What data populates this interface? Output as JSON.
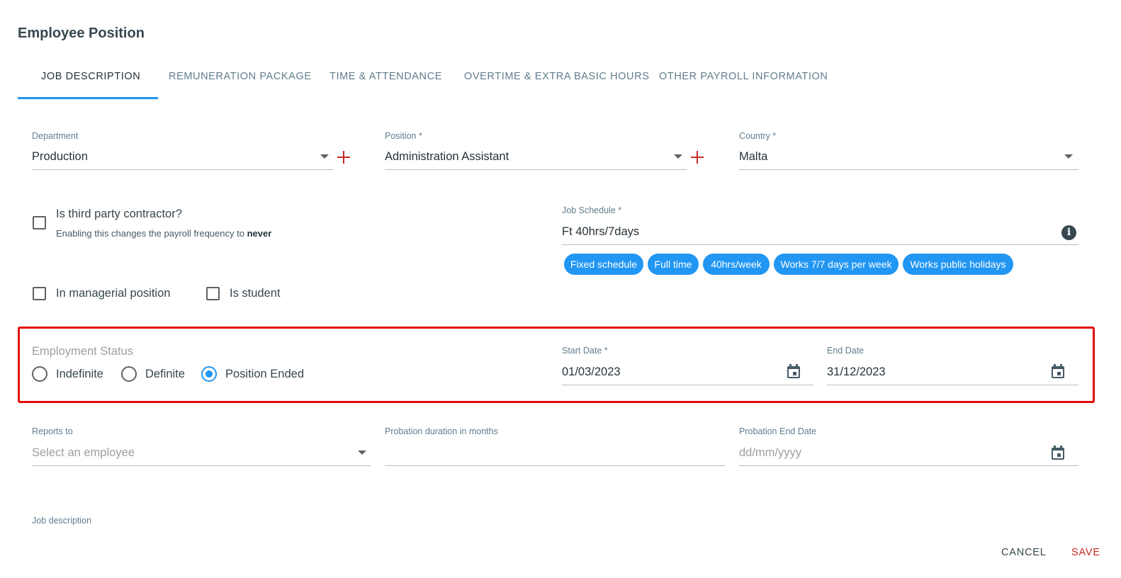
{
  "dialog": {
    "title": "Employee Position"
  },
  "tabs": [
    {
      "label": "JOB DESCRIPTION",
      "active": true
    },
    {
      "label": "REMUNERATION PACKAGE",
      "active": false
    },
    {
      "label": "TIME & ATTENDANCE",
      "active": false
    },
    {
      "label": "OVERTIME & EXTRA BASIC HOURS",
      "active": false
    },
    {
      "label": "OTHER PAYROLL INFORMATION",
      "active": false
    }
  ],
  "department": {
    "label": "Department",
    "value": "Production"
  },
  "position": {
    "label": "Position *",
    "value": "Administration Assistant"
  },
  "country": {
    "label": "Country *",
    "value": "Malta"
  },
  "third_party": {
    "label": "Is third party contractor?",
    "hint": "Enabling this changes the payroll frequency to ",
    "hint_bold": "never",
    "checked": false
  },
  "job_schedule": {
    "label": "Job Schedule *",
    "value": "Ft 40hrs/7days",
    "chips": [
      "Fixed schedule",
      "Full time",
      "40hrs/week",
      "Works 7/7 days per week",
      "Works public holidays"
    ]
  },
  "managerial": {
    "label": "In managerial position",
    "checked": false
  },
  "student": {
    "label": "Is student",
    "checked": false
  },
  "employment_status": {
    "label": "Employment Status",
    "options": [
      "Indefinite",
      "Definite",
      "Position Ended"
    ],
    "selected": "Position Ended"
  },
  "start_date": {
    "label": "Start Date *",
    "value": "01/03/2023"
  },
  "end_date": {
    "label": "End Date",
    "value": "31/12/2023"
  },
  "reports_to": {
    "label": "Reports to",
    "placeholder": "Select an employee"
  },
  "probation_duration": {
    "label": "Probation duration in months",
    "value": ""
  },
  "probation_end": {
    "label": "Probation End Date",
    "placeholder": "dd/mm/yyyy"
  },
  "job_description": {
    "label": "Job description"
  },
  "actions": {
    "cancel": "CANCEL",
    "save": "SAVE"
  },
  "colors": {
    "accent": "#2196f3",
    "danger": "#c62828",
    "highlight": "#e10a0a"
  }
}
